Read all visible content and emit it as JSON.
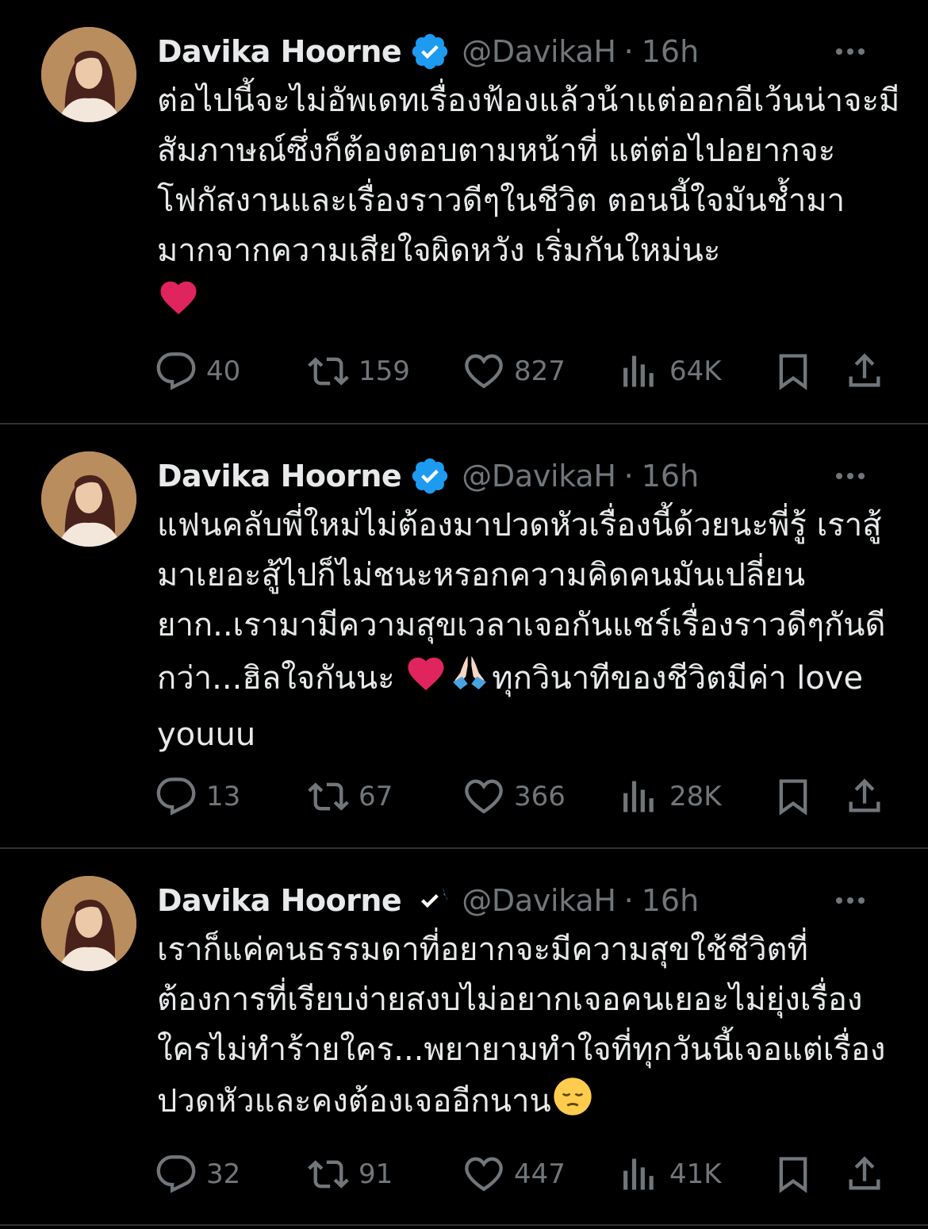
{
  "icons": [
    "verified-badge-icon",
    "more-icon",
    "reply-icon",
    "retweet-icon",
    "like-icon",
    "views-icon",
    "bookmark-icon",
    "share-icon",
    "heart-emoji",
    "pray-emoji",
    "pensive-emoji"
  ],
  "colors": {
    "background": "#000000",
    "text": "#e7e9ea",
    "muted": "#71767b",
    "verified": "#1d9bf0",
    "divider": "#2f3336"
  },
  "tweets": [
    {
      "name": "Davika Hoorne",
      "handle": "@DavikaH",
      "sep": "·",
      "time": "16h",
      "text": "ต่อไปนี้จะไม่อัพเดทเรื่องฟ้องแล้วน้าแต่ออกอีเว้นน่าจะมีสัมภาษณ์ซึ่งก็ต้องตอบตามหน้าที่ แต่ต่อไปอยากจะโฟกัสงานและเรื่องราวดีๆในชีวิต ตอนนี้ใจมันช้ำมามากจากความเสียใจผิดหวัง เริ่มกันใหม่นะ",
      "replies": "40",
      "retweets": "159",
      "likes": "827",
      "views": "64K"
    },
    {
      "name": "Davika Hoorne",
      "handle": "@DavikaH",
      "sep": "·",
      "time": "16h",
      "text_a": "แฟนคลับพี่ใหม่ไม่ต้องมาปวดหัวเรื่องนี้ด้วยนะพี่รู้ เราสู้มาเยอะสู้ไปก็ไม่ชนะหรอกความคิดคนมันเปลี่ยนยาก..เรามามีความสุขเวลาเจอกันแชร์เรื่องราวดีๆกันดีกว่า...ฮิลใจกันนะ ",
      "text_b": "ทุกวินาทีของชีวิตมีค่า love youuu",
      "replies": "13",
      "retweets": "67",
      "likes": "366",
      "views": "28K"
    },
    {
      "name": "Davika Hoorne",
      "handle": "@DavikaH",
      "sep": "·",
      "time": "16h",
      "text": "เราก็แค่คนธรรมดาที่อยากจะมีความสุขใช้ชีวิตที่ต้องการที่เรียบง่ายสงบไม่อยากเจอคนเยอะไม่ยุ่งเรื่องใครไม่ทำร้ายใคร...พยายามทำใจที่ทุกวันนี้เจอแต่เรื่องปวดหัวและคงต้องเจออีกนาน",
      "replies": "32",
      "retweets": "91",
      "likes": "447",
      "views": "41K"
    }
  ]
}
